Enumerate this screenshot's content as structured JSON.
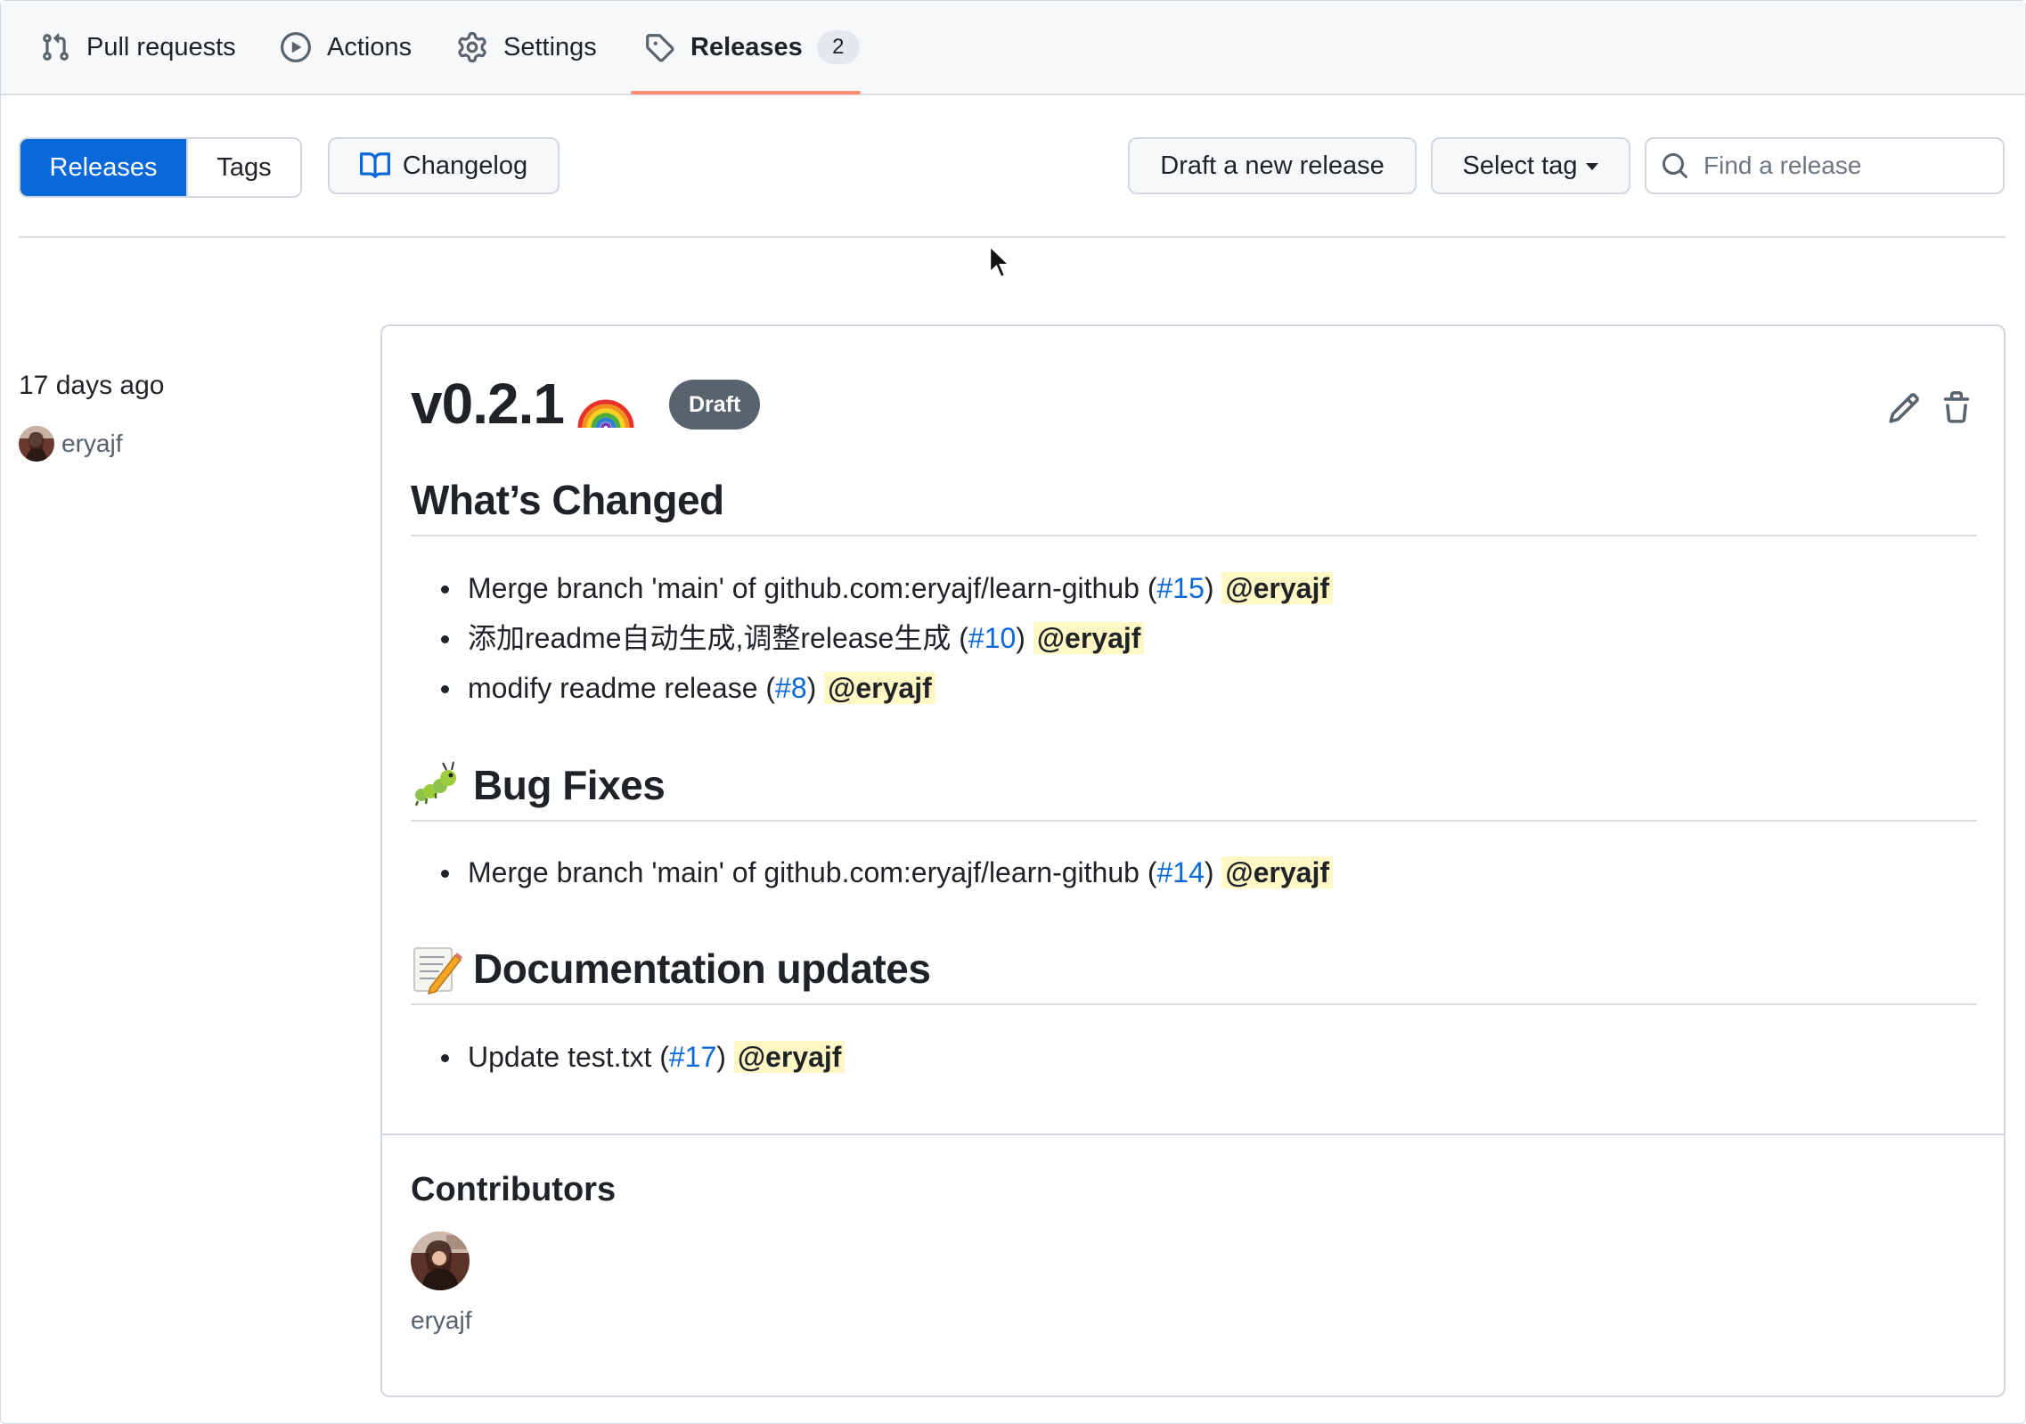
{
  "nav": {
    "items": [
      {
        "label": "Pull requests",
        "icon": "git-pull-request-icon"
      },
      {
        "label": "Actions",
        "icon": "play-icon"
      },
      {
        "label": "Settings",
        "icon": "gear-icon"
      },
      {
        "label": "Releases",
        "icon": "tag-icon",
        "count": "2",
        "active": true
      }
    ]
  },
  "toolbar": {
    "releases_tab": "Releases",
    "tags_tab": "Tags",
    "changelog": "Changelog",
    "draft_new": "Draft a new release",
    "select_tag": "Select tag",
    "search_placeholder": "Find a release"
  },
  "release": {
    "time_ago": "17 days ago",
    "author": "eryajf",
    "version": "v0.2.1",
    "status": "Draft",
    "sections": [
      {
        "title": "What’s Changed",
        "items": [
          {
            "text": "Merge branch 'main' of github.com:eryajf/learn-github (",
            "pr": "#15",
            "close": ")",
            "mention": "@eryajf"
          },
          {
            "text": "添加readme自动生成,调整release生成 (",
            "pr": "#10",
            "close": ")",
            "mention": "@eryajf"
          },
          {
            "text": "modify readme release (",
            "pr": "#8",
            "close": ")",
            "mention": "@eryajf"
          }
        ]
      },
      {
        "title": "Bug Fixes",
        "emoji": "bug-emoji-icon",
        "items": [
          {
            "text": "Merge branch 'main' of github.com:eryajf/learn-github (",
            "pr": "#14",
            "close": ")",
            "mention": "@eryajf"
          }
        ]
      },
      {
        "title": "Documentation updates",
        "emoji": "memo-emoji-icon",
        "items": [
          {
            "text": "Update test.txt (",
            "pr": "#17",
            "close": ")",
            "mention": "@eryajf"
          }
        ]
      }
    ],
    "contributors_title": "Contributors",
    "contributors": [
      "eryajf"
    ]
  },
  "colors": {
    "accent": "#0969da",
    "tab_underline": "#fd8c73",
    "mention_bg": "#fff8c5",
    "draft_badge": "#59636e"
  }
}
